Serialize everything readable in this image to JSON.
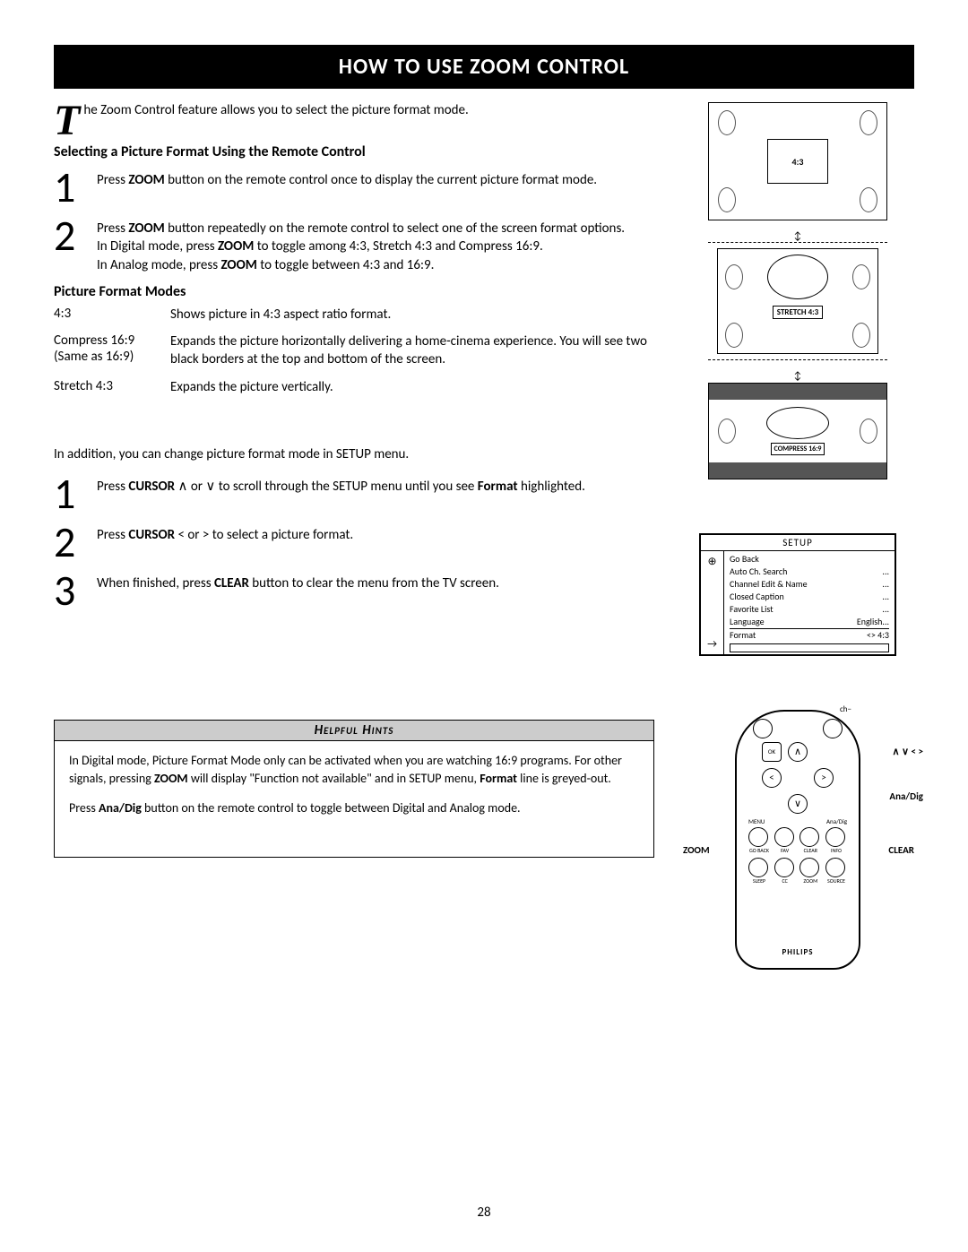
{
  "title": "HOW TO USE ZOOM CONTROL",
  "dropcap": "T",
  "intro": "he Zoom Control feature allows you to select the picture format mode.",
  "section1_head": "Selecting a Picture Format Using the Remote Control",
  "step1": {
    "num": "1",
    "pre": "Press ",
    "bold": "ZOOM",
    "post": " button on the remote control once to display the current picture format mode."
  },
  "step2": {
    "num": "2",
    "p1a": "Press ",
    "p1b": "ZOOM",
    "p1c": " button repeatedly on the remote control to select one of the screen format options.",
    "p2a": "In Digital mode, press ",
    "p2b": "ZOOM",
    "p2c": " to toggle among 4:3, Stretch 4:3 and Compress 16:9.",
    "p3a": "In Analog mode, press ",
    "p3b": "ZOOM",
    "p3c": " to toggle between 4:3 and 16:9."
  },
  "section2_head": "Picture Format Modes",
  "modes": [
    {
      "label": "4:3",
      "desc": "Shows picture in 4:3 aspect ratio format."
    },
    {
      "labelA": "Compress 16:9",
      "labelB": "(Same as 16:9)",
      "desc": "Expands the picture horizontally delivering a home-cinema experience. You will see two black borders at the top and bottom of the screen."
    },
    {
      "label": "Stretch 4:3",
      "desc": "Expands the picture vertically."
    }
  ],
  "addition": "In addition, you can change picture format mode in SETUP menu.",
  "stepB1": {
    "num": "1",
    "a": "Press ",
    "b": "CURSOR",
    "c": " ∧ or ∨ to scroll through the SETUP menu until you see ",
    "d": "Format",
    "e": " highlighted."
  },
  "stepB2": {
    "num": "2",
    "a": "Press ",
    "b": "CURSOR",
    "c": " < or > to select a picture format."
  },
  "stepB3": {
    "num": "3",
    "a": "When finished, press ",
    "b": "CLEAR",
    "c": " button to clear the menu from the TV screen."
  },
  "hints_head": "Helpful Hints",
  "hint1a": "In Digital mode, Picture Format Mode only can be activated when you are watching 16:9 programs. For other signals, pressing ",
  "hint1b": "ZOOM",
  "hint1c": " will display \"Function not available\" and in SETUP menu, ",
  "hint1d": "Format",
  "hint1e": " line is greyed-out.",
  "hint2a": "Press ",
  "hint2b": "Ana/Dig",
  "hint2c": " button on the remote control to toggle between Digital and Analog mode.",
  "diagrams": {
    "ratio43": "4:3",
    "stretch43": "STRETCH 4:3",
    "compress169": "COMPRESS 16:9"
  },
  "setup": {
    "title": "SETUP",
    "items": [
      {
        "label": "Go Back",
        "val": ""
      },
      {
        "label": "Auto Ch. Search",
        "val": "..."
      },
      {
        "label": "Channel Edit & Name",
        "val": "..."
      },
      {
        "label": "Closed Caption",
        "val": "..."
      },
      {
        "label": "Favorite List",
        "val": "..."
      },
      {
        "label": "Language",
        "val": "English..."
      },
      {
        "label": "Format",
        "val": "<> 4:3"
      }
    ],
    "arrow": "→"
  },
  "remote": {
    "ch": "ch−",
    "ok": "OK",
    "menu": "MENU",
    "anadig": "Ana/Dig",
    "row2": [
      "GO BACK",
      "FAV",
      "CLEAR",
      "INFO"
    ],
    "row3": [
      "SLEEP",
      "CC",
      "ZOOM",
      "SOURCE"
    ],
    "brand": "PHILIPS",
    "call_arrows": "∧  ∨  <  >",
    "call_anadig": "Ana/Dig",
    "call_zoom": "ZOOM",
    "call_clear": "CLEAR"
  },
  "page_num": "28"
}
